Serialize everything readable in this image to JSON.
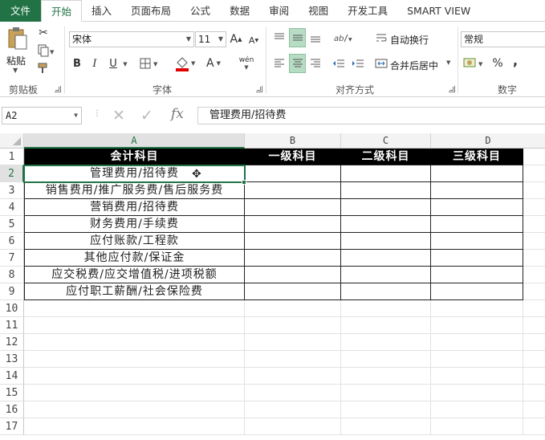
{
  "tabs": [
    {
      "label": "文件"
    },
    {
      "label": "开始"
    },
    {
      "label": "插入"
    },
    {
      "label": "页面布局"
    },
    {
      "label": "公式"
    },
    {
      "label": "数据"
    },
    {
      "label": "审阅"
    },
    {
      "label": "视图"
    },
    {
      "label": "开发工具"
    },
    {
      "label": "SMART VIEW"
    }
  ],
  "ribbon": {
    "clipboard": {
      "paste_label": "粘贴",
      "group_label": "剪贴板"
    },
    "font": {
      "font_name": "宋体",
      "font_size": "11",
      "group_label": "字体",
      "bold": "B",
      "italic": "I",
      "underline": "U",
      "grow": "A",
      "shrink": "A",
      "font_color": "A",
      "phonetic": "wén"
    },
    "alignment": {
      "wrap_text": "自动换行",
      "merge_center": "合并后居中",
      "group_label": "对齐方式"
    },
    "number": {
      "format": "常规",
      "group_label": "数字",
      "percent": "%",
      "comma": ","
    }
  },
  "formula_bar": {
    "name_box": "A2",
    "formula": "管理费用/招待费",
    "fx": "fx"
  },
  "columns": [
    "A",
    "B",
    "C",
    "D"
  ],
  "rows": [
    "1",
    "2",
    "3",
    "4",
    "5",
    "6",
    "7",
    "8",
    "9",
    "10",
    "11",
    "12",
    "13",
    "14",
    "15",
    "16",
    "17"
  ],
  "table": {
    "headers": [
      "会计科目",
      "一级科目",
      "二级科目",
      "三级科目"
    ],
    "accounts": [
      "管理费用/招待费",
      "销售费用/推广服务费/售后服务费",
      "营销费用/招待费",
      "财务费用/手续费",
      "应付账款/工程款",
      "其他应付款/保证金",
      "应交税费/应交增值税/进项税额",
      "应付职工薪酬/社会保险费"
    ]
  },
  "colors": {
    "accent": "#217346",
    "header_bg": "#000000",
    "header_fg": "#ffffff"
  }
}
